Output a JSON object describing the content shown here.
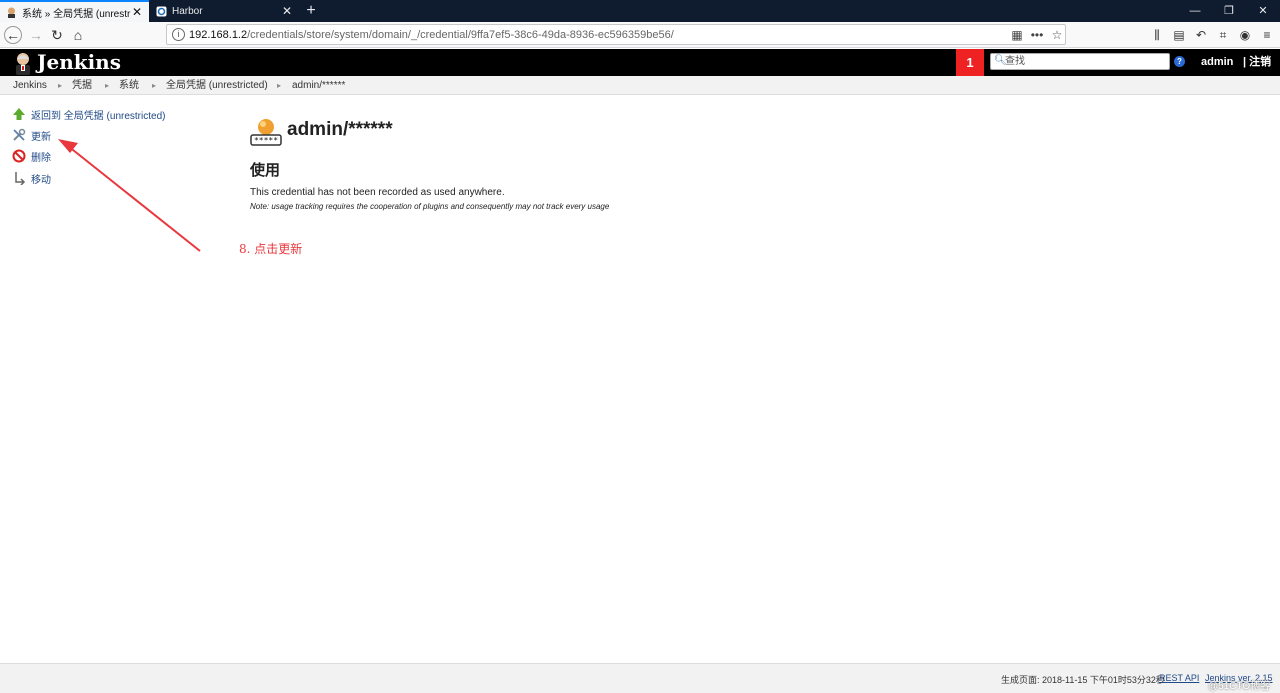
{
  "browser": {
    "tabs": [
      {
        "title": "系统 » 全局凭据 (unrestricted)",
        "active": true
      },
      {
        "title": "Harbor",
        "active": false
      }
    ],
    "url_host": "192.168.1.2",
    "url_path": "/credentials/store/system/domain/_/credential/9ffa7ef5-38c6-49da-8936-ec596359be56/"
  },
  "header": {
    "logo_text": "Jenkins",
    "notification_count": "1",
    "search_placeholder": "查找",
    "user": "admin",
    "logout": "| 注销"
  },
  "breadcrumb": [
    "Jenkins",
    "凭据",
    "系统",
    "全局凭据 (unrestricted)",
    "admin/******"
  ],
  "side_panel": {
    "items": [
      {
        "label": "返回到 全局凭据 (unrestricted)",
        "icon": "up-arrow-icon"
      },
      {
        "label": "更新",
        "icon": "wrench-screwdriver-icon"
      },
      {
        "label": "删除",
        "icon": "no-entry-icon"
      },
      {
        "label": "移动",
        "icon": "move-icon"
      }
    ]
  },
  "main": {
    "title": "admin/******",
    "section_title": "使用",
    "usage_text": "This credential has not been recorded as used anywhere.",
    "usage_note": "Note: usage tracking requires the cooperation of plugins and consequently may not track every usage"
  },
  "annotation": {
    "text": "8. 点击更新",
    "color": "#e8383d"
  },
  "footer": {
    "generated": "生成页面: 2018-11-15 下午01时53分32秒",
    "rest_api": "REST API",
    "version": "Jenkins ver. 2.15",
    "watermark": "@51CTO博客"
  }
}
